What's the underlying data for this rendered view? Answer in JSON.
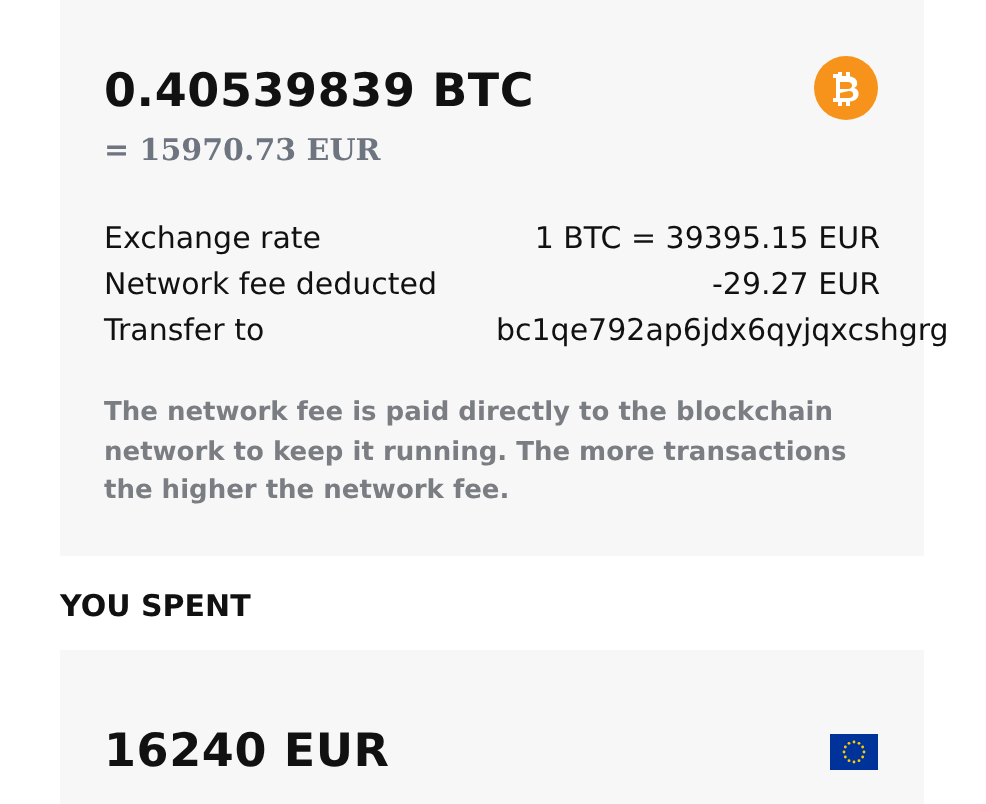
{
  "received": {
    "amount": "0.40539839 BTC",
    "equivalent": "= 15970.73 EUR",
    "details": [
      {
        "label": "Exchange rate",
        "value": "1 BTC = 39395.15 EUR",
        "kind": "amount"
      },
      {
        "label": "Network fee deducted",
        "value": "-29.27 EUR",
        "kind": "amount"
      },
      {
        "label": "Transfer to",
        "value": "bc1qe792ap6jdx6qyjqxcshgrg",
        "kind": "address"
      }
    ],
    "note": "The network fee is paid directly to the blockchain network to keep it running. The more transactions the higher the network fee."
  },
  "spent": {
    "heading": "YOU SPENT",
    "amount": "16240 EUR"
  }
}
